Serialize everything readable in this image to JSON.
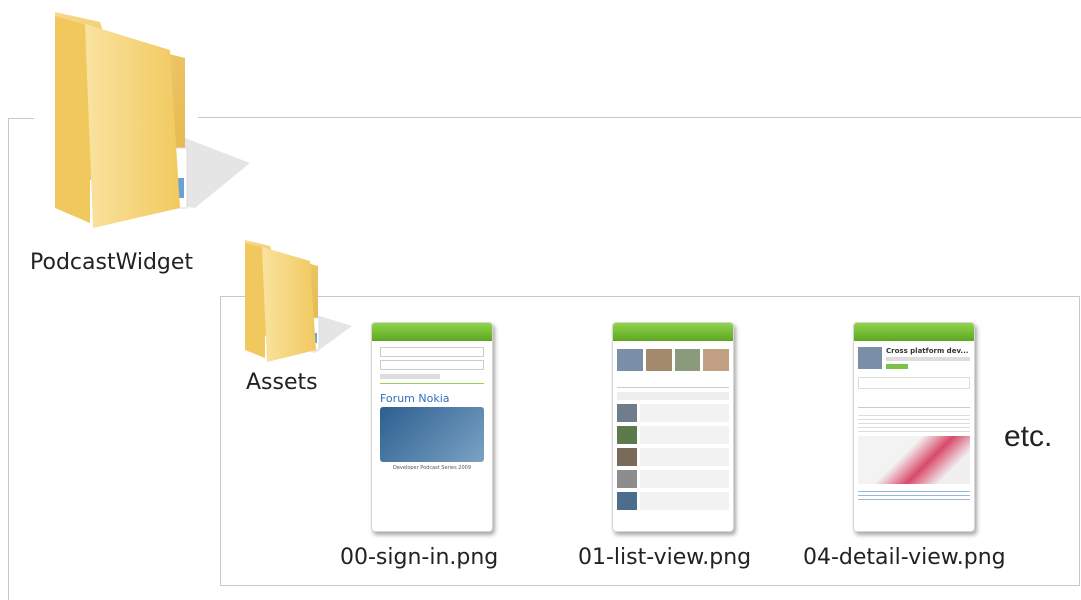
{
  "root_folder": {
    "name": "PodcastWidget",
    "icon": "folder-icon"
  },
  "assets_folder": {
    "name": "Assets",
    "icon": "folder-icon"
  },
  "files": [
    {
      "name": "00-sign-in.png",
      "brand": "Forum Nokia",
      "caption": "Developer Podcast Series 2009"
    },
    {
      "name": "01-list-view.png"
    },
    {
      "name": "04-detail-view.png",
      "headline": "Cross platform dev..."
    }
  ],
  "more_label": "etc.",
  "colors": {
    "folder": "#f2c65e",
    "border": "#c8c8c8",
    "app_bar": "#6cb52d"
  }
}
